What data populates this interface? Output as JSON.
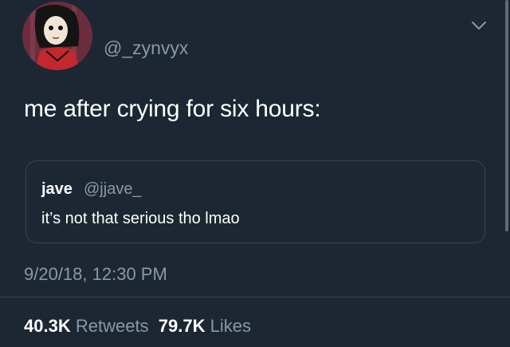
{
  "author": {
    "handle": "@_zynvyx",
    "avatar_icon": "cartoon-portrait-avatar"
  },
  "menu_icon": "chevron-down-icon",
  "tweet": {
    "text": "me after crying for six hours:"
  },
  "quoted_tweet": {
    "name": "jave",
    "handle": "@jjave_",
    "text": "it’s not that serious tho lmao"
  },
  "timestamp": "9/20/18, 12:30 PM",
  "stats": {
    "retweets_count": "40.3K",
    "retweets_label": "Retweets",
    "likes_count": "79.7K",
    "likes_label": "Likes"
  },
  "colors": {
    "background": "#1c2733",
    "muted_text": "#8899a6",
    "border": "#38444d"
  }
}
